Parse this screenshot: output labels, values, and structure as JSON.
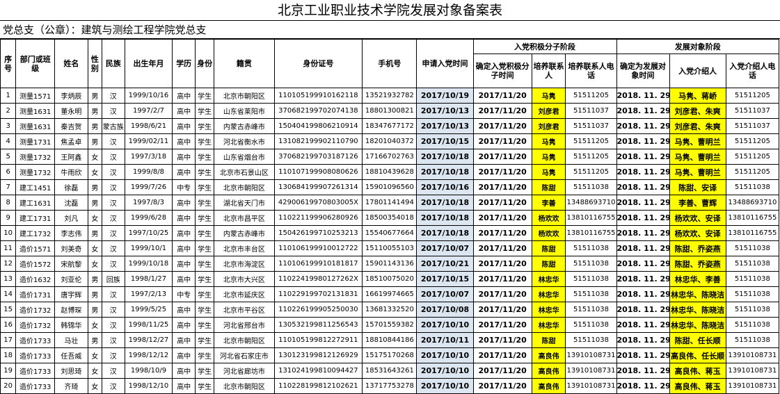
{
  "title": "北京工业职业技术学院发展对象备案表",
  "branch": "党总支（公章）：建筑与测绘工程学院党总支",
  "headers": {
    "seq": "序号",
    "class": "部门或班级",
    "name": "姓名",
    "gender": "性别",
    "ethnicity": "民族",
    "birth": "出生年月",
    "edu": "学历",
    "identity": "身份",
    "origin": "籍贯",
    "id_number": "身份证号",
    "phone": "手机号",
    "apply_date": "申请入党时间",
    "activist_stage": "入党积极分子阶段",
    "activist_date": "确定入党积极分子时间",
    "trainer": "培养联系人",
    "trainer_phone": "培养联系人电话",
    "dev_stage": "发展对象阶段",
    "dev_date": "确定为发展对象时间",
    "introducer": "入党介绍人",
    "introducer_phone": "入党介绍人电话"
  },
  "rows": [
    {
      "seq": "1",
      "class": "测量1571",
      "name": "李炳辰",
      "gender": "男",
      "ethnicity": "汉",
      "birth": "1999/10/16",
      "edu": "高中",
      "identity": "学生",
      "origin": "北京市朝阳区",
      "id_number": "110105199910162118",
      "phone": "13521932782",
      "apply_date": "2017/10/19",
      "activist_date": "2017/11/20",
      "trainer": "马隽",
      "trainer_phone": "51511205",
      "dev_date": "2018. 11. 29",
      "introducer": "马隽、蒋峤",
      "introducer_phone": "51511205"
    },
    {
      "seq": "2",
      "class": "测量1631",
      "name": "董永明",
      "gender": "男",
      "ethnicity": "汉",
      "birth": "1997/2/7",
      "edu": "高中",
      "identity": "学生",
      "origin": "山东省莱阳市",
      "id_number": "370682199702074138",
      "phone": "18801300821",
      "apply_date": "2017/10/13",
      "activist_date": "2017/11/20",
      "trainer": "刘彦君",
      "trainer_phone": "51511037",
      "dev_date": "2018. 11. 29",
      "introducer": "刘彦君、朱爽",
      "introducer_phone": "51511037"
    },
    {
      "seq": "3",
      "class": "测量1631",
      "name": "秦吉贺",
      "gender": "男",
      "ethnicity": "蒙古族",
      "birth": "1998/6/21",
      "edu": "高中",
      "identity": "学生",
      "origin": "内蒙古赤峰市",
      "id_number": "150404199806210914",
      "phone": "18347677172",
      "apply_date": "2017/10/13",
      "activist_date": "2017/11/20",
      "trainer": "刘彦君",
      "trainer_phone": "51511037",
      "dev_date": "2018. 11. 29",
      "introducer": "刘彦君、朱爽",
      "introducer_phone": "51511037"
    },
    {
      "seq": "4",
      "class": "测量1731",
      "name": "焦孟卓",
      "gender": "男",
      "ethnicity": "汉",
      "birth": "1999/02/11",
      "edu": "高中",
      "identity": "学生",
      "origin": "河北省衡水市",
      "id_number": "131082199902110790",
      "phone": "18201040372",
      "apply_date": "2017/10/15",
      "activist_date": "2017/11/20",
      "trainer": "马隽",
      "trainer_phone": "51511205",
      "dev_date": "2018. 11. 29",
      "introducer": "马隽、曹明兰",
      "introducer_phone": "51511205"
    },
    {
      "seq": "5",
      "class": "测量1732",
      "name": "王阿鑫",
      "gender": "女",
      "ethnicity": "汉",
      "birth": "1997/3/18",
      "edu": "高中",
      "identity": "学生",
      "origin": "山东省烟台市",
      "id_number": "370682199703187126",
      "phone": "17166702763",
      "apply_date": "2017/10/18",
      "activist_date": "2017/11/20",
      "trainer": "马隽",
      "trainer_phone": "51511205",
      "dev_date": "2018. 11. 29",
      "introducer": "马隽、曹明兰",
      "introducer_phone": "51511205"
    },
    {
      "seq": "6",
      "class": "测量1732",
      "name": "牛雨欣",
      "gender": "女",
      "ethnicity": "汉",
      "birth": "1999/8/8",
      "edu": "高中",
      "identity": "学生",
      "origin": "北京市石景山区",
      "id_number": "110107199908080626",
      "phone": "18810439628",
      "apply_date": "2017/10/18",
      "activist_date": "2017/11/20",
      "trainer": "马隽",
      "trainer_phone": "51511205",
      "dev_date": "2018. 11. 29",
      "introducer": "马隽、曹明兰",
      "introducer_phone": "51511205"
    },
    {
      "seq": "7",
      "class": "建工1451",
      "name": "徐磊",
      "gender": "男",
      "ethnicity": "汉",
      "birth": "1999/7/26",
      "edu": "中专",
      "identity": "学生",
      "origin": "北京市朝阳区",
      "id_number": "130684199907261314",
      "phone": "15901096560",
      "apply_date": "2017/10/16",
      "activist_date": "2017/11/20",
      "trainer": "陈甜",
      "trainer_phone": "51511038",
      "dev_date": "2018. 11. 29",
      "introducer": "陈甜、安译",
      "introducer_phone": "51511038"
    },
    {
      "seq": "8",
      "class": "建工1631",
      "name": "沈磊",
      "gender": "男",
      "ethnicity": "汉",
      "birth": "1997/8/3",
      "edu": "高中",
      "identity": "学生",
      "origin": "湖北省天门市",
      "id_number": "42900619970803005X",
      "phone": "17801141494",
      "apply_date": "2017/10/18",
      "activist_date": "2017/11/20",
      "trainer": "李善",
      "trainer_phone": "13488693710",
      "dev_date": "2018. 11. 29",
      "introducer": "李善、曹辉",
      "introducer_phone": "13488693710"
    },
    {
      "seq": "9",
      "class": "建工1731",
      "name": "刘凡",
      "gender": "女",
      "ethnicity": "汉",
      "birth": "1999/6/28",
      "edu": "高中",
      "identity": "学生",
      "origin": "北京市昌平区",
      "id_number": "110221199906280926",
      "phone": "18500354018",
      "apply_date": "2017/10/18",
      "activist_date": "2017/11/20",
      "trainer": "杨欢欢",
      "trainer_phone": "13810116755",
      "dev_date": "2018. 11. 29",
      "introducer": "杨欢欢、安译",
      "introducer_phone": "13810116755"
    },
    {
      "seq": "10",
      "class": "建工1732",
      "name": "李志伟",
      "gender": "男",
      "ethnicity": "汉",
      "birth": "1997/10/25",
      "edu": "高中",
      "identity": "学生",
      "origin": "内蒙古赤峰市",
      "id_number": "150426199710253213",
      "phone": "15540677664",
      "apply_date": "2017/10/18",
      "activist_date": "2017/11/20",
      "trainer": "杨欢欢",
      "trainer_phone": "13810116755",
      "dev_date": "2018. 11. 29",
      "introducer": "杨欢欢、安译",
      "introducer_phone": "13810116755"
    },
    {
      "seq": "11",
      "class": "造价1571",
      "name": "刘美奇",
      "gender": "女",
      "ethnicity": "汉",
      "birth": "1999/10/1",
      "edu": "高中",
      "identity": "学生",
      "origin": "北京市丰台区",
      "id_number": "110106199910012722",
      "phone": "15110055103",
      "apply_date": "2017/10/07",
      "activist_date": "2017/11/20",
      "trainer": "陈甜",
      "trainer_phone": "51511038",
      "dev_date": "2018. 11. 29",
      "introducer": "陈甜、乔姿燕",
      "introducer_phone": "51511038"
    },
    {
      "seq": "12",
      "class": "造价1572",
      "name": "宋航黎",
      "gender": "女",
      "ethnicity": "汉",
      "birth": "1999/10/18",
      "edu": "高中",
      "identity": "学生",
      "origin": "北京市海淀区",
      "id_number": "110106199910181817",
      "phone": "15901143136",
      "apply_date": "2017/10/21",
      "activist_date": "2017/11/20",
      "trainer": "陈甜",
      "trainer_phone": "51511038",
      "dev_date": "2018. 11. 29",
      "introducer": "陈甜、乔姿燕",
      "introducer_phone": "51511038"
    },
    {
      "seq": "13",
      "class": "造价1632",
      "name": "刘亚伦",
      "gender": "男",
      "ethnicity": "回族",
      "birth": "1998/1/27",
      "edu": "高中",
      "identity": "学生",
      "origin": "北京市大兴区",
      "id_number": "11022419980127262X",
      "phone": "18510075020",
      "apply_date": "2017/10/15",
      "activist_date": "2017/11/20",
      "trainer": "林忠华",
      "trainer_phone": "51511038",
      "dev_date": "2018. 11. 29",
      "introducer": "林忠华、李善",
      "introducer_phone": "51511038"
    },
    {
      "seq": "14",
      "class": "造价1731",
      "name": "唐宇辉",
      "gender": "男",
      "ethnicity": "汉",
      "birth": "1997/2/13",
      "edu": "中专",
      "identity": "学生",
      "origin": "北京市延庆区",
      "id_number": "110229199702131831",
      "phone": "16619974665",
      "apply_date": "2017/10/07",
      "activist_date": "2017/11/20",
      "trainer": "林忠华",
      "trainer_phone": "51511038",
      "dev_date": "2018. 11. 29",
      "introducer": "林忠华、陈晓洁",
      "introducer_phone": "51511038"
    },
    {
      "seq": "15",
      "class": "造价1732",
      "name": "赵博琛",
      "gender": "男",
      "ethnicity": "汉",
      "birth": "1999/5/25",
      "edu": "高中",
      "identity": "学生",
      "origin": "北京市平谷区",
      "id_number": "110226199905250030",
      "phone": "13681332520",
      "apply_date": "2017/10/08",
      "activist_date": "2017/11/20",
      "trainer": "林忠华",
      "trainer_phone": "51511038",
      "dev_date": "2018. 11. 29",
      "introducer": "林忠华、陈晓洁",
      "introducer_phone": "51511038"
    },
    {
      "seq": "16",
      "class": "造价1732",
      "name": "韩锦华",
      "gender": "女",
      "ethnicity": "汉",
      "birth": "1998/11/25",
      "edu": "高中",
      "identity": "学生",
      "origin": "河北省邢台市",
      "id_number": "130532199811256543",
      "phone": "15701559382",
      "apply_date": "2017/10/10",
      "activist_date": "2017/11/20",
      "trainer": "林忠华",
      "trainer_phone": "51511038",
      "dev_date": "2018. 11. 29",
      "introducer": "林忠华、陈晓洁",
      "introducer_phone": "51511038"
    },
    {
      "seq": "17",
      "class": "造价1733",
      "name": "马壮",
      "gender": "男",
      "ethnicity": "汉",
      "birth": "1998/12/27",
      "edu": "高中",
      "identity": "学生",
      "origin": "北京市朝阳区",
      "id_number": "110105199812272911",
      "phone": "18810844186",
      "apply_date": "2017/10/11",
      "activist_date": "2017/11/20",
      "trainer": "陈甜",
      "trainer_phone": "51511038",
      "dev_date": "2018. 11. 29",
      "introducer": "陈甜、任长顺",
      "introducer_phone": "51511038"
    },
    {
      "seq": "18",
      "class": "造价1733",
      "name": "任吾威",
      "gender": "女",
      "ethnicity": "汉",
      "birth": "1998/12/12",
      "edu": "高中",
      "identity": "学生",
      "origin": "河北省石家庄市",
      "id_number": "130123199812126929",
      "phone": "15175170268",
      "apply_date": "2017/10/10",
      "activist_date": "2017/11/20",
      "trainer": "高良伟",
      "trainer_phone": "13910108731",
      "dev_date": "2018. 11. 29",
      "introducer": "高良伟、任长顺",
      "introducer_phone": "13910108731"
    },
    {
      "seq": "19",
      "class": "造价1733",
      "name": "刘思琦",
      "gender": "女",
      "ethnicity": "汉",
      "birth": "1998/10/9",
      "edu": "高中",
      "identity": "学生",
      "origin": "河北省廊坊市",
      "id_number": "131024199810094427",
      "phone": "18531643261",
      "apply_date": "2017/10/10",
      "activist_date": "2017/11/20",
      "trainer": "高良伟",
      "trainer_phone": "13910108731",
      "dev_date": "2018. 11. 29",
      "introducer": "高良伟、蒋玉",
      "introducer_phone": "13910108731"
    },
    {
      "seq": "20",
      "class": "造价1733",
      "name": "齐琦",
      "gender": "女",
      "ethnicity": "汉",
      "birth": "1998/12/10",
      "edu": "高中",
      "identity": "学生",
      "origin": "北京市朝阳区",
      "id_number": "110228199812102621",
      "phone": "13717753278",
      "apply_date": "2017/10/10",
      "activist_date": "2017/11/20",
      "trainer": "高良伟",
      "trainer_phone": "13910108731",
      "dev_date": "2018. 11. 29",
      "introducer": "高良伟、蒋玉",
      "introducer_phone": "13910108731"
    }
  ]
}
